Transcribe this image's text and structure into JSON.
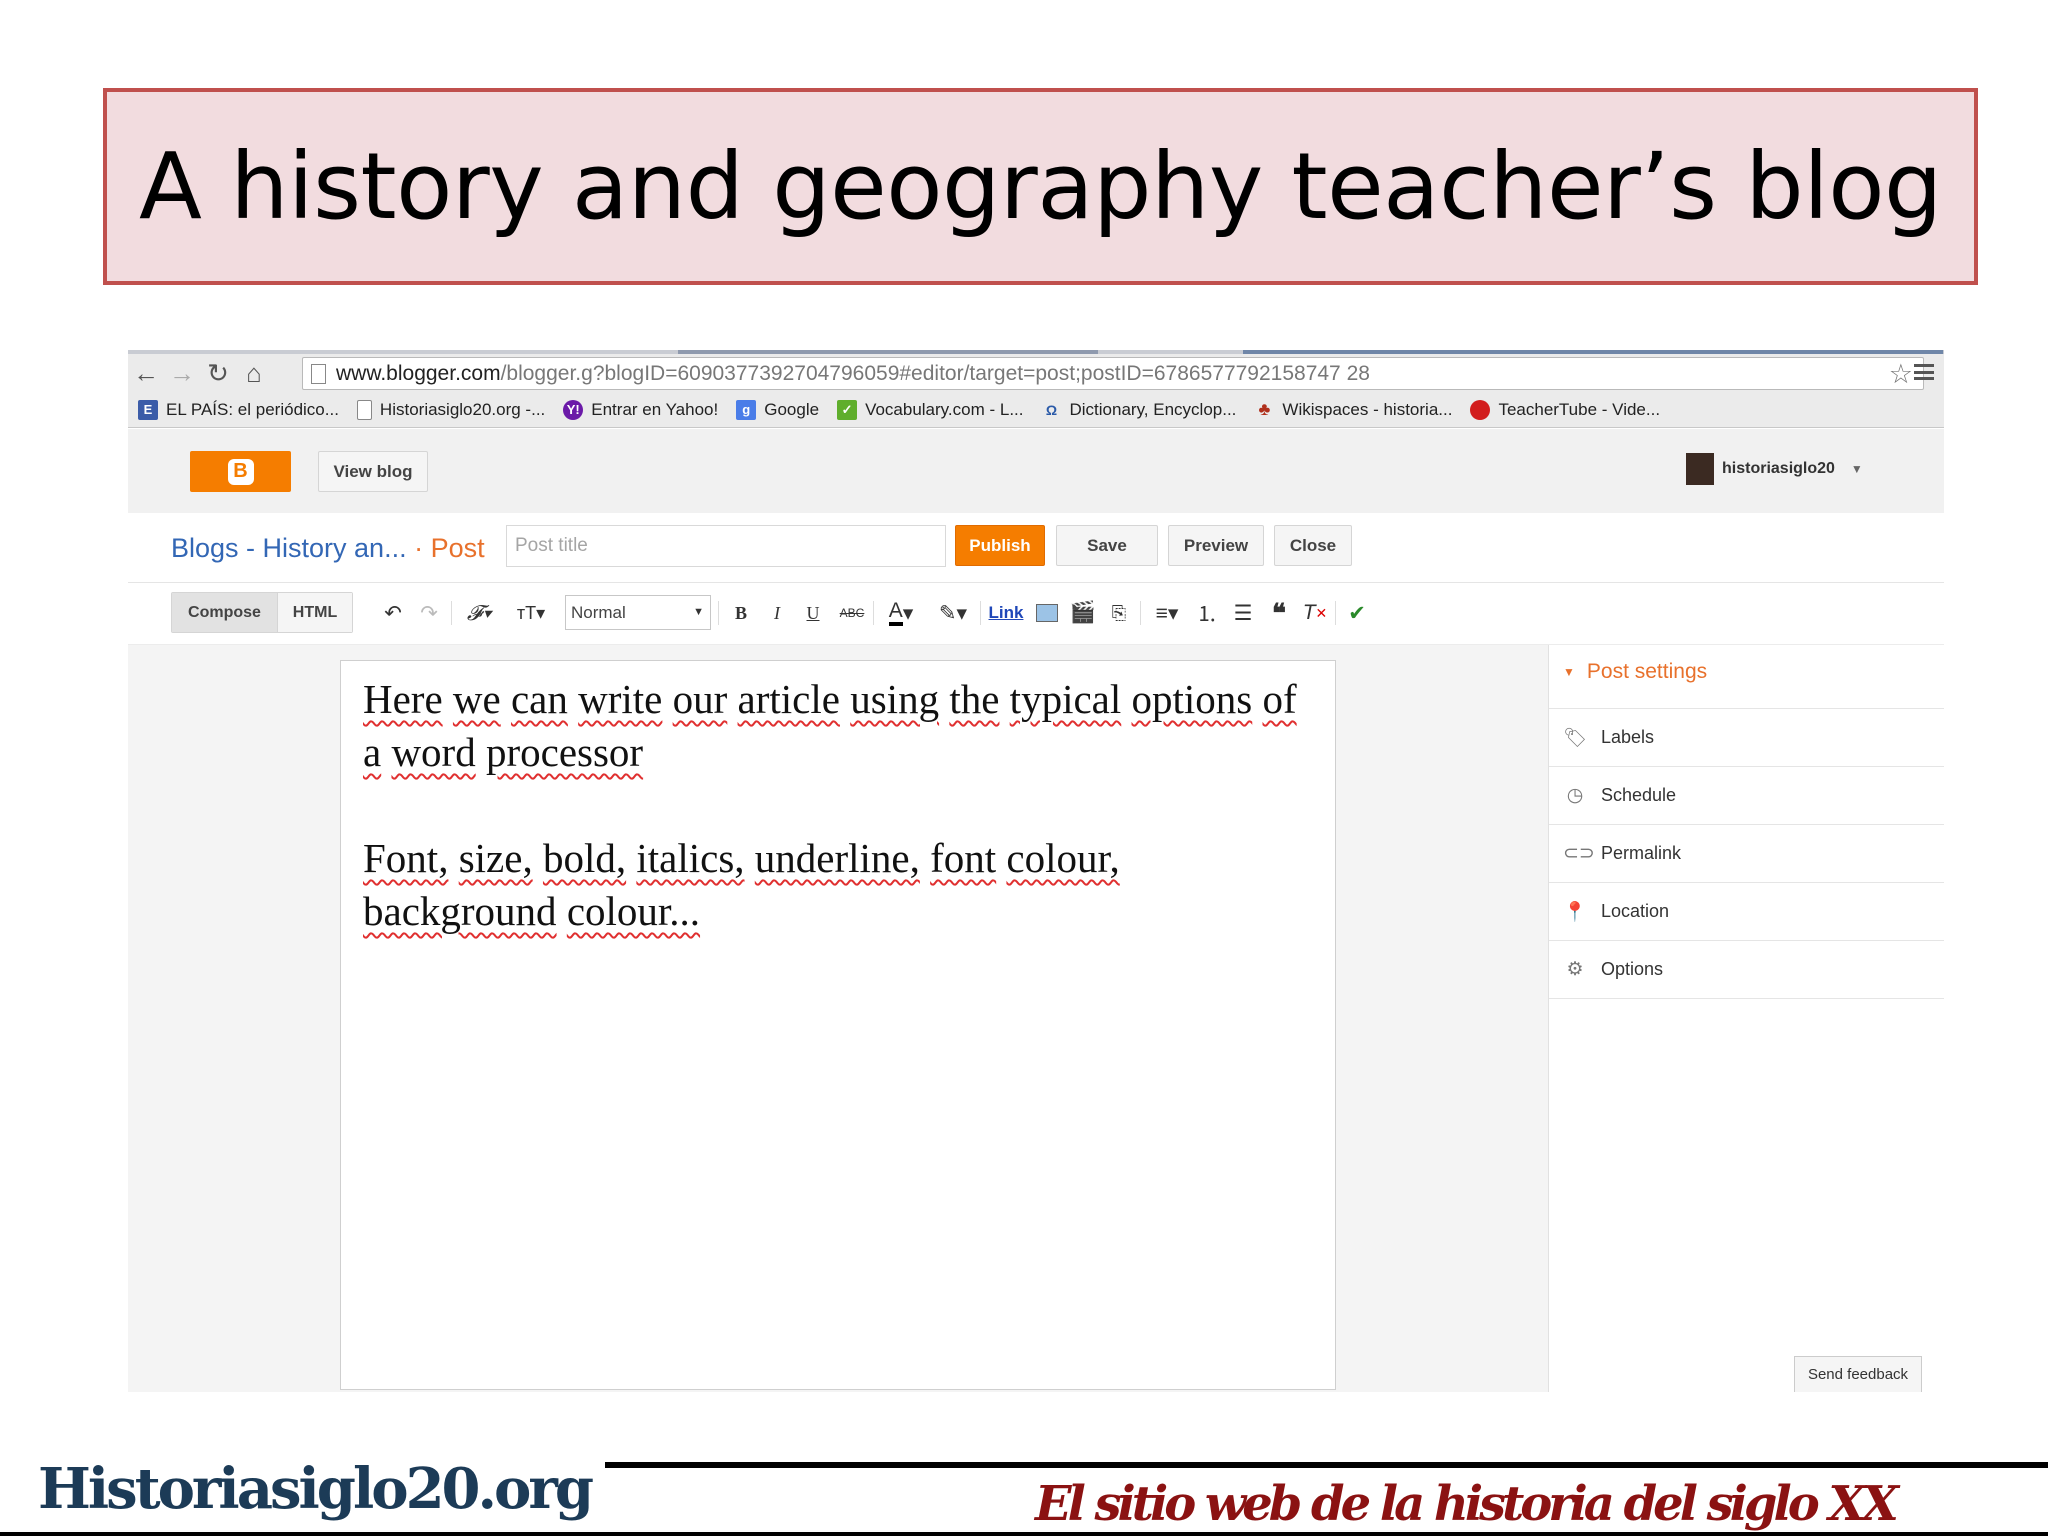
{
  "slide": {
    "title": "A history and geography teacher’s blog"
  },
  "browser": {
    "url_host": "www.blogger.com",
    "url_path": "/blogger.g?blogID=6090377392704796059#editor/target=post;postID=6786577792158747 28",
    "bookmarks": [
      {
        "label": "EL PAÍS: el periódico...",
        "icon": "elpais-icon",
        "color": "#3b5ca8"
      },
      {
        "label": "Historiasiglo20.org -...",
        "icon": "page-icon",
        "color": "#ffffff"
      },
      {
        "label": "Entrar en Yahoo!",
        "icon": "yahoo-icon",
        "color": "#6b1aa8"
      },
      {
        "label": "Google",
        "icon": "google-icon",
        "color": "#4a7de8"
      },
      {
        "label": "Vocabulary.com - L...",
        "icon": "vocabulary-icon",
        "color": "#5fae2c"
      },
      {
        "label": "Dictionary, Encyclop...",
        "icon": "dictionary-icon",
        "color": "#ffffff"
      },
      {
        "label": "Wikispaces - historia...",
        "icon": "wikispaces-icon",
        "color": "#ffffff"
      },
      {
        "label": "TeacherTube - Vide...",
        "icon": "teachertube-icon",
        "color": "#ffffff"
      }
    ]
  },
  "blogger": {
    "view_blog": "View blog",
    "username": "historiasiglo20",
    "breadcrumb": "Blogs - History an...",
    "breadcrumb_sep": "·",
    "breadcrumb_post": "Post",
    "post_title_placeholder": "Post title",
    "publish": "Publish",
    "save": "Save",
    "preview": "Preview",
    "close": "Close"
  },
  "toolbar": {
    "compose": "Compose",
    "html": "HTML",
    "format": "Normal",
    "link": "Link"
  },
  "editor": {
    "paragraphs": [
      "Here we can write our article using the typical options of a word processor",
      "Font, size, bold, italics, underline, font colour, background colour..."
    ]
  },
  "post_settings": {
    "heading": "Post settings",
    "items": [
      "Labels",
      "Schedule",
      "Permalink",
      "Location",
      "Options"
    ]
  },
  "feedback": "Send feedback",
  "footer": {
    "site": "Historiasiglo20.org",
    "tagline": "El sitio web de la historia del siglo XX"
  },
  "colors": {
    "title_fill": "#f2dcdf",
    "title_border": "#c0504d",
    "blogger_orange": "#f57d00",
    "link_blue": "#3367b5"
  }
}
